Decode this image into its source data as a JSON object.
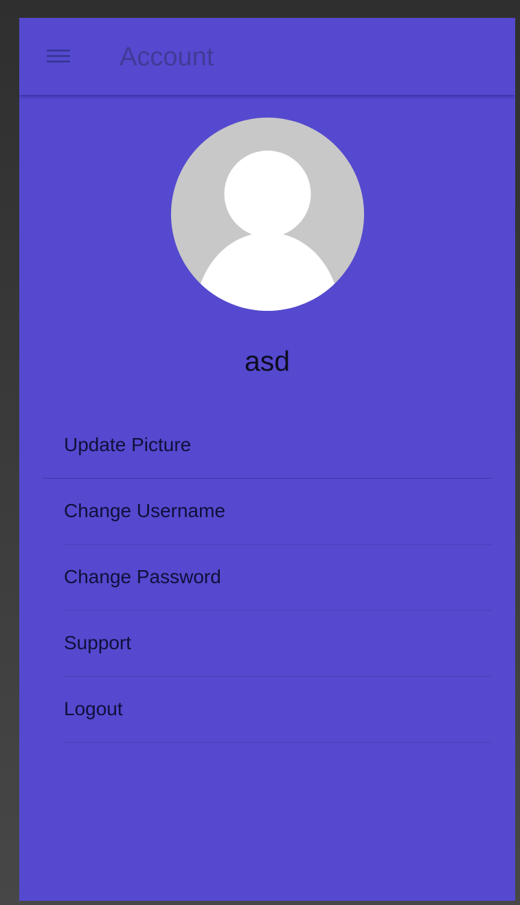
{
  "app_bar": {
    "title": "Account",
    "menu_icon": "hamburger-menu-icon"
  },
  "profile": {
    "avatar_icon": "default-avatar-icon",
    "username": "asd"
  },
  "menu": {
    "items": [
      {
        "label": "Update Picture"
      },
      {
        "label": "Change Username"
      },
      {
        "label": "Change Password"
      },
      {
        "label": "Support"
      },
      {
        "label": "Logout"
      }
    ]
  },
  "colors": {
    "primary": "#5549cf",
    "avatar_background": "#c8c8c8",
    "avatar_figure": "#ffffff",
    "text": "#10103a"
  }
}
